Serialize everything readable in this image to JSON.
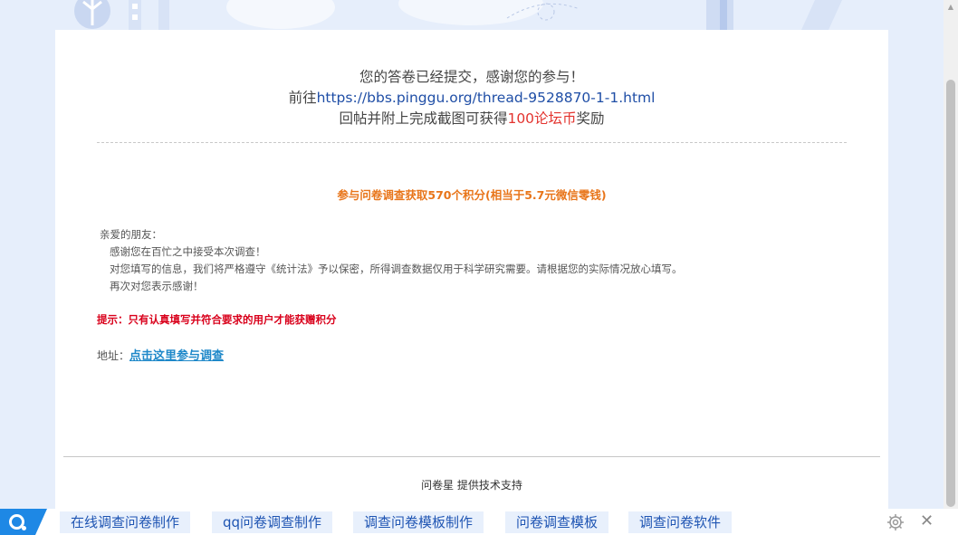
{
  "header": {
    "line1": "您的答卷已经提交，感谢您的参与！",
    "line2_prefix": "前往",
    "line2_link": "https://bbs.pinggu.org/thread-9528870-1-1.html",
    "line3_prefix": "回帖并附上完成截图可获得",
    "line3_reward": "100论坛币",
    "line3_suffix": "奖励"
  },
  "highlight": "参与问卷调查获取570个积分(相当于5.7元微信零钱)",
  "letter": {
    "greeting": "亲爱的朋友：",
    "p1": "感谢您在百忙之中接受本次调查！",
    "p2": "对您填写的信息，我们将严格遵守《统计法》予以保密，所得调查数据仅用于科学研究需要。请根据您的实际情况放心填写。",
    "p3": "再次对您表示感谢！"
  },
  "tip": "提示：只有认真填写并符合要求的用户才能获赠积分",
  "address": {
    "label": "地址：",
    "link": "点击这里参与调查"
  },
  "footer": "问卷星 提供技术支持",
  "bottom_bar": {
    "tags": [
      "在线调查问卷制作",
      "qq问卷调查制作",
      "调查问卷模板制作",
      "问卷调查模板",
      "调查问卷软件"
    ]
  },
  "colors": {
    "accent_blue": "#1e88e5",
    "reward_red": "#e3342f",
    "highlight_orange": "#e8751a",
    "tip_red": "#d9001b"
  }
}
